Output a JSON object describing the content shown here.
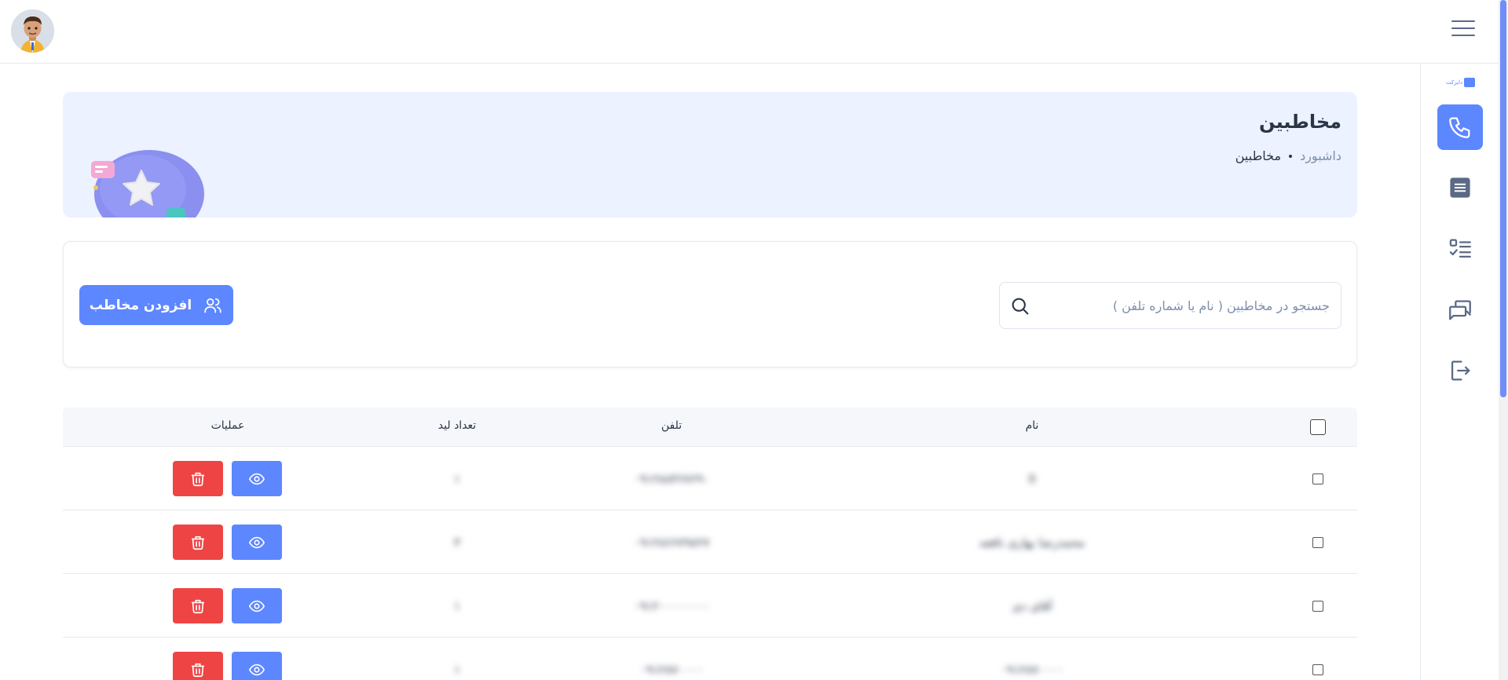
{
  "header": {
    "title": "مخاطبین",
    "breadcrumb_home": "داشبورد",
    "breadcrumb_current": "مخاطبین"
  },
  "sidebar": {
    "logo_text": "دایرکت",
    "items": [
      {
        "icon": "phone-icon",
        "active": true
      },
      {
        "icon": "list-icon",
        "active": false
      },
      {
        "icon": "checklist-icon",
        "active": false
      },
      {
        "icon": "messages-icon",
        "active": false
      },
      {
        "icon": "logout-icon",
        "active": false
      }
    ]
  },
  "toolbar": {
    "search_placeholder": "جستجو در مخاطبین ( نام یا شماره تلفن )",
    "add_label": "افزودن مخاطب"
  },
  "table": {
    "columns": {
      "name": "نام",
      "phone": "تلفن",
      "leads": "تعداد لید",
      "ops": "عملیات"
    },
    "rows": [
      {
        "name": "II",
        "phone": "۰۹۱۲۸۸۴۶۷۶۹۰",
        "leads": "۱"
      },
      {
        "name": "محمدرضا بهاری نافعه",
        "phone": "۰۹۱۲۸۶۶۷۹۸۲۷",
        "leads": "۳"
      },
      {
        "name": "آقای دی",
        "phone": "۰۹۱۲۰۰۰۰۰۰۰۰",
        "leads": "۱"
      },
      {
        "name": "۰۹۱۲۸۷۰۰۰۰",
        "phone": "۰۹۱۲۸۷۰۰۰۰",
        "leads": "۱"
      }
    ]
  },
  "colors": {
    "primary": "#5d87ff",
    "danger": "#ef4444",
    "header_bg": "#ecf2ff",
    "text": "#2a3547"
  }
}
